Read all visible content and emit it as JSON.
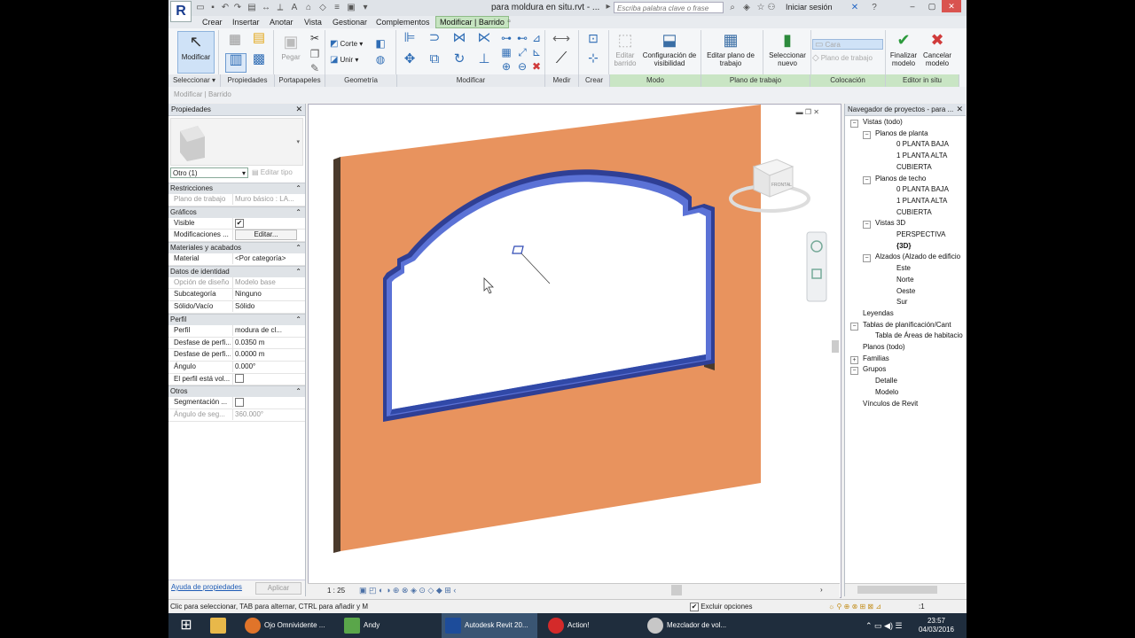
{
  "title_bar": {
    "app_logo": "R",
    "document_title": "para moldura en situ.rvt - ...",
    "search_placeholder": "Escriba palabra clave o frase",
    "signin_label": "Iniciar sesión"
  },
  "menu_tabs": [
    "Crear",
    "Insertar",
    "Anotar",
    "Vista",
    "Gestionar",
    "Complementos",
    "Modificar | Barrido"
  ],
  "ribbon": {
    "modify_label": "Modificar",
    "paste_label": "Pegar",
    "cut_label": "Corte",
    "join_label": "Unir",
    "edit_sweep_label": "Editar barrido",
    "visibility_label": "Configuración de visibilidad",
    "edit_workplane_label": "Editar plano de trabajo",
    "select_new_label": "Seleccionar nuevo",
    "host_label": "Cara",
    "workplane_small_label": "Plano de trabajo",
    "finish_label": "Finalizar modelo",
    "cancel_label": "Cancelar modelo",
    "panels": [
      "Seleccionar ▾",
      "Propiedades",
      "Portapapeles",
      "Geometría",
      "Modificar",
      "Medir",
      "Crear",
      "Modo",
      "Plano de trabajo",
      "Colocación",
      "Editor in situ"
    ]
  },
  "context_bar": "Modificar | Barrido",
  "properties": {
    "title": "Propiedades",
    "type_selector": "Otro (1)",
    "edit_type": "Editar tipo",
    "groups": [
      {
        "name": "Restricciones",
        "rows": [
          {
            "k": "Plano de trabajo",
            "v": "Muro básico : LA...",
            "dim": true
          }
        ]
      },
      {
        "name": "Gráficos",
        "rows": [
          {
            "k": "Visible",
            "v": "✔",
            "check": true
          },
          {
            "k": "Modificaciones ...",
            "v": "Editar...",
            "button": true
          }
        ]
      },
      {
        "name": "Materiales y acabados",
        "rows": [
          {
            "k": "Material",
            "v": "<Por categoría>"
          }
        ]
      },
      {
        "name": "Datos de identidad",
        "rows": [
          {
            "k": "Opción de diseño",
            "v": "Modelo base",
            "dim": true
          },
          {
            "k": "Subcategoría",
            "v": "Ninguno"
          },
          {
            "k": "Sólido/Vacío",
            "v": "Sólido"
          }
        ]
      },
      {
        "name": "Perfil",
        "rows": [
          {
            "k": "Perfil",
            "v": "modura de cl..."
          },
          {
            "k": "Desfase de perfi...",
            "v": "0.0350 m"
          },
          {
            "k": "Desfase de perfi...",
            "v": "0.0000 m"
          },
          {
            "k": "Ángulo",
            "v": "0.000°"
          },
          {
            "k": "El perfil está vol...",
            "v": "",
            "check": true
          }
        ]
      },
      {
        "name": "Otros",
        "rows": [
          {
            "k": "Segmentación ...",
            "v": "",
            "check": true
          },
          {
            "k": "Ángulo de seg...",
            "v": "360.000°",
            "dim": true
          }
        ]
      }
    ],
    "help_link": "Ayuda de propiedades",
    "apply_label": "Aplicar"
  },
  "viewport": {
    "scale": "1 : 25",
    "viewcube_label": "FRONTAL"
  },
  "browser": {
    "title": "Navegador de proyectos - para ...",
    "items": [
      {
        "label": "Vistas (todo)",
        "level": 0,
        "toggle": "−"
      },
      {
        "label": "Planos de planta",
        "level": 1,
        "toggle": "−"
      },
      {
        "label": "0 PLANTA BAJA",
        "level": 2
      },
      {
        "label": "1 PLANTA ALTA",
        "level": 2
      },
      {
        "label": "CUBIERTA",
        "level": 2
      },
      {
        "label": "Planos de techo",
        "level": 1,
        "toggle": "−"
      },
      {
        "label": "0 PLANTA BAJA",
        "level": 2
      },
      {
        "label": "1 PLANTA ALTA",
        "level": 2
      },
      {
        "label": "CUBIERTA",
        "level": 2
      },
      {
        "label": "Vistas 3D",
        "level": 1,
        "toggle": "−"
      },
      {
        "label": "PERSPECTIVA",
        "level": 2
      },
      {
        "label": "{3D}",
        "level": 2,
        "bold": true
      },
      {
        "label": "Alzados (Alzado de edificio",
        "level": 1,
        "toggle": "−"
      },
      {
        "label": "Este",
        "level": 2
      },
      {
        "label": "Norte",
        "level": 2
      },
      {
        "label": "Oeste",
        "level": 2
      },
      {
        "label": "Sur",
        "level": 2
      },
      {
        "label": "Leyendas",
        "level": 0
      },
      {
        "label": "Tablas de planificación/Cant",
        "level": 0,
        "toggle": "−"
      },
      {
        "label": "Tabla de Áreas de habitacio",
        "level": 1
      },
      {
        "label": "Planos (todo)",
        "level": 0
      },
      {
        "label": "Familias",
        "level": 0,
        "toggle": "+"
      },
      {
        "label": "Grupos",
        "level": 0,
        "toggle": "−"
      },
      {
        "label": "Detalle",
        "level": 1
      },
      {
        "label": "Modelo",
        "level": 1
      },
      {
        "label": "Vínculos de Revit",
        "level": 0
      }
    ]
  },
  "status": {
    "hint": "Clic para seleccionar, TAB para alternar, CTRL para añadir y M",
    "exclude_options": "Excluir opciones",
    "filter_count": ":1"
  },
  "taskbar": {
    "items": [
      "Ojo Omnividente ...",
      "Andy",
      "Autodesk Revit 20...",
      "Action!",
      "Mezclador de vol..."
    ],
    "time": "23:57",
    "date": "04/03/2016"
  },
  "colors": {
    "wall": "#e8935e",
    "wall_dark": "#4a3a2c",
    "molding": "#3f5bc8",
    "ribbon_active": "#c6e4c1"
  }
}
